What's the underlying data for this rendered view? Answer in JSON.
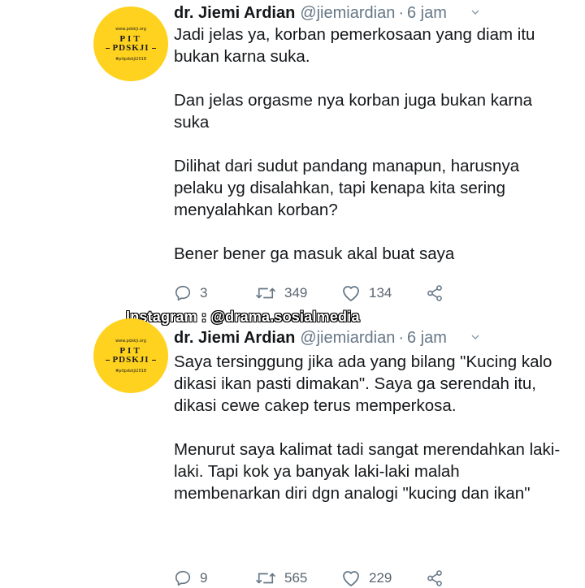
{
  "watermark": "Instagram : @drama.sosialmedia",
  "tweets": [
    {
      "avatar": {
        "url": "www.pdskji.org",
        "line1": "PIT",
        "line2": "PDSKJI",
        "tag": "#pitpdskji2018"
      },
      "name": "dr. Jiemi Ardian",
      "handle": "@jiemiardian",
      "separator": "·",
      "time": "6 jam",
      "paragraphs": [
        "Jadi jelas ya, korban pemerkosaan yang diam itu bukan karna suka.",
        "Dan jelas orgasme nya korban juga bukan karna suka",
        "Dilihat dari sudut pandang manapun, harusnya pelaku yg disalahkan, tapi kenapa kita sering menyalahkan korban?",
        "Bener bener ga masuk akal buat saya"
      ],
      "replies": "3",
      "retweets": "349",
      "likes": "134"
    },
    {
      "avatar": {
        "url": "www.pdskji.org",
        "line1": "PIT",
        "line2": "PDSKJI",
        "tag": "#pitpdskji2018"
      },
      "name": "dr. Jiemi Ardian",
      "handle": "@jiemiardian",
      "separator": "·",
      "time": "6 jam",
      "paragraphs": [
        "Saya tersinggung jika ada yang bilang \"Kucing kalo dikasi ikan pasti dimakan\". Saya ga serendah itu, dikasi cewe cakep terus memperkosa.",
        "Menurut saya kalimat tadi sangat merendahkan laki-laki. Tapi kok ya banyak laki-laki malah membenarkan diri dgn analogi \"kucing dan ikan\""
      ],
      "replies": "9",
      "retweets": "565",
      "likes": "229"
    }
  ],
  "icons": {
    "reply": "reply-icon",
    "retweet": "retweet-icon",
    "like": "heart-icon",
    "share": "share-icon",
    "caret": "chevron-down-icon"
  },
  "colors": {
    "avatar_bg": "#ffd21f",
    "secondary_text": "#657786",
    "primary_text": "#14171a"
  }
}
